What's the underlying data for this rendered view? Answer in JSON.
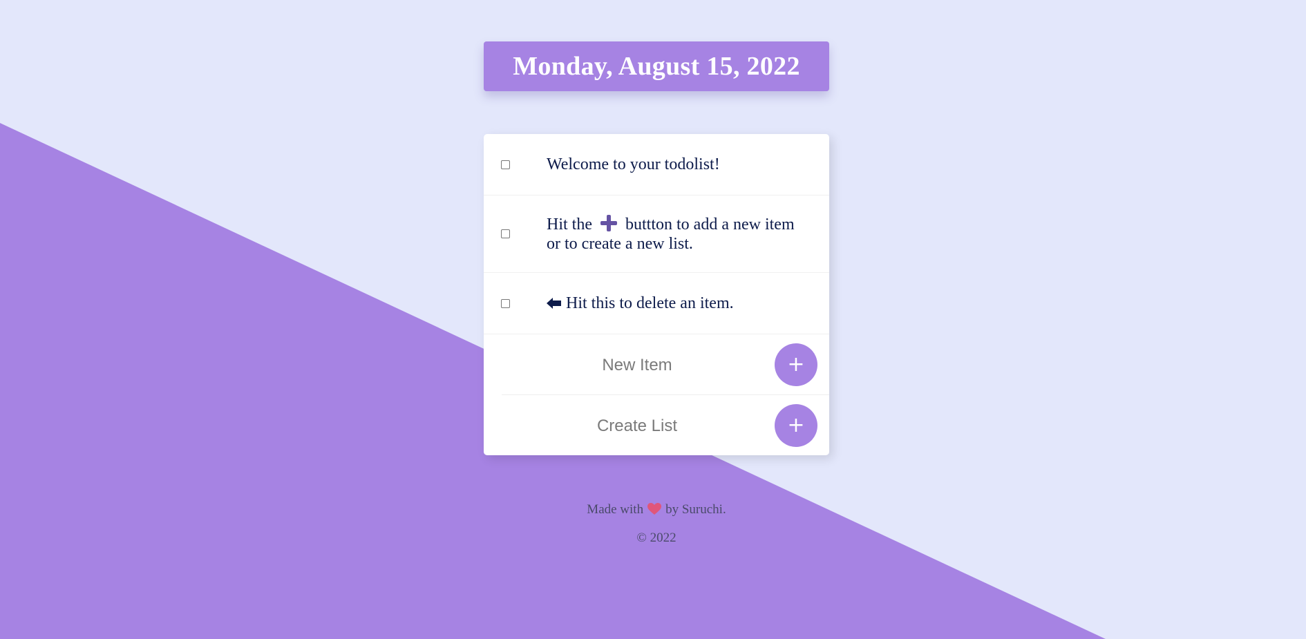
{
  "header": {
    "date": "Monday, August 15, 2022"
  },
  "todos": {
    "items": [
      {
        "text": "Welcome to your todolist!",
        "checked": false
      },
      {
        "text_before": "Hit the",
        "icon": "plus-icon",
        "text_after": "buttton to add a new item or to create a new list.",
        "checked": false
      },
      {
        "icon": "arrow-left-icon",
        "text": "Hit this to delete an item.",
        "checked": false
      }
    ]
  },
  "new_item": {
    "placeholder": "New Item",
    "button_label": "+"
  },
  "create_list": {
    "placeholder": "Create List",
    "button_label": "+"
  },
  "footer": {
    "made_with": "Made with",
    "heart_icon": "heart-icon",
    "by": "by Suruchi.",
    "copyright": "© 2022"
  },
  "colors": {
    "background": "#e3e7fb",
    "accent": "#a683e3",
    "text": "#0d1b4a",
    "heart": "#e0567a"
  }
}
